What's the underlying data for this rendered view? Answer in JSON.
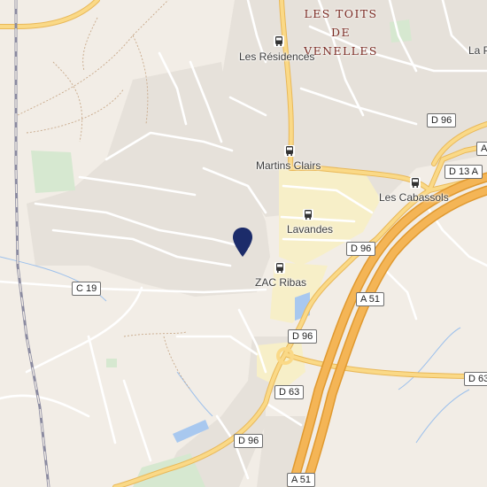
{
  "map": {
    "colors": {
      "background": "#f2ede6",
      "urban": "#e6e1da",
      "zone": "#f7efc8",
      "motorway": "#f4b556",
      "primary": "#f8d07a",
      "water": "#a8c8ef",
      "park": "#d6e8d0",
      "street": "#ffffff",
      "rail": "#8a8aa0",
      "pin": "#1c2c6a"
    },
    "district_label": {
      "line1": "LES TOITS DE",
      "line2": "VENELLES"
    },
    "place_labels": {
      "partial_top_right": "La P",
      "residences": "Les Résidences",
      "martins_clairs": "Martins Clairs",
      "cabassols": "Les Cabassols",
      "lavandes": "Lavandes",
      "zac_ribas": "ZAC Ribas"
    },
    "road_shields": {
      "d96_top": "D 96",
      "a_partial": "A",
      "d13a": "D 13 A",
      "d96_mid": "D 96",
      "c19": "C 19",
      "a51_mid": "A 51",
      "d96_low": "D 96",
      "d63_right": "D 63",
      "d63": "D 63",
      "d96_bottom": "D 96",
      "a51_bottom": "A 51"
    },
    "pin_icon": "location-pin-icon",
    "bus_icon": "bus-stop-icon"
  }
}
